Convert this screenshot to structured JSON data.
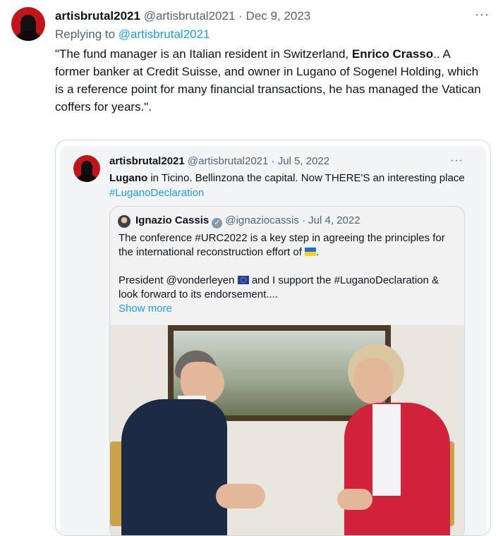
{
  "tweet": {
    "author_name": "artisbrutal2021",
    "author_handle": "@artisbrutal2021",
    "separator": "·",
    "date": "Dec 9, 2023",
    "more_icon": "more-dots-icon",
    "replying_prefix": "Replying to",
    "replying_handle": "@artisbrutal2021",
    "text_part1": "\"The fund manager is an Italian resident in Switzerland, ",
    "text_bold": "Enrico Crasso",
    "text_part2": ".. A former banker at Credit Suisse, and owner in Lugano of Sogenel Holding, which is a reference point for many financial  transactions, he has managed the Vatican coffers for years.\"."
  },
  "quoted": {
    "author_name": "artisbrutal2021",
    "author_handle": "@artisbrutal2021",
    "separator": "·",
    "date": "Jul 5, 2022",
    "text_bold": "Lugano",
    "text_rest": " in Ticino.  Bellinzona the capital. Now THERE'S an interesting place",
    "hashtag": "#LuganoDeclaration"
  },
  "nested": {
    "author_name": "Ignazio Cassis",
    "author_handle": "@ignaziocassis",
    "separator": "·",
    "date": "Jul 4, 2022",
    "line1": "The conference #URC2022 is a key step in agreeing the principles for",
    "line2": "the international reconstruction effort of",
    "line2_end": ".",
    "line3_a": "President @vonderleyen",
    "line3_b": " and I support the #LuganoDeclaration &",
    "line4": "look forward to its endorsement....",
    "show_more": "Show more"
  },
  "colors": {
    "link": "#1d9bf0",
    "muted": "#536471",
    "text": "#0f1419"
  }
}
